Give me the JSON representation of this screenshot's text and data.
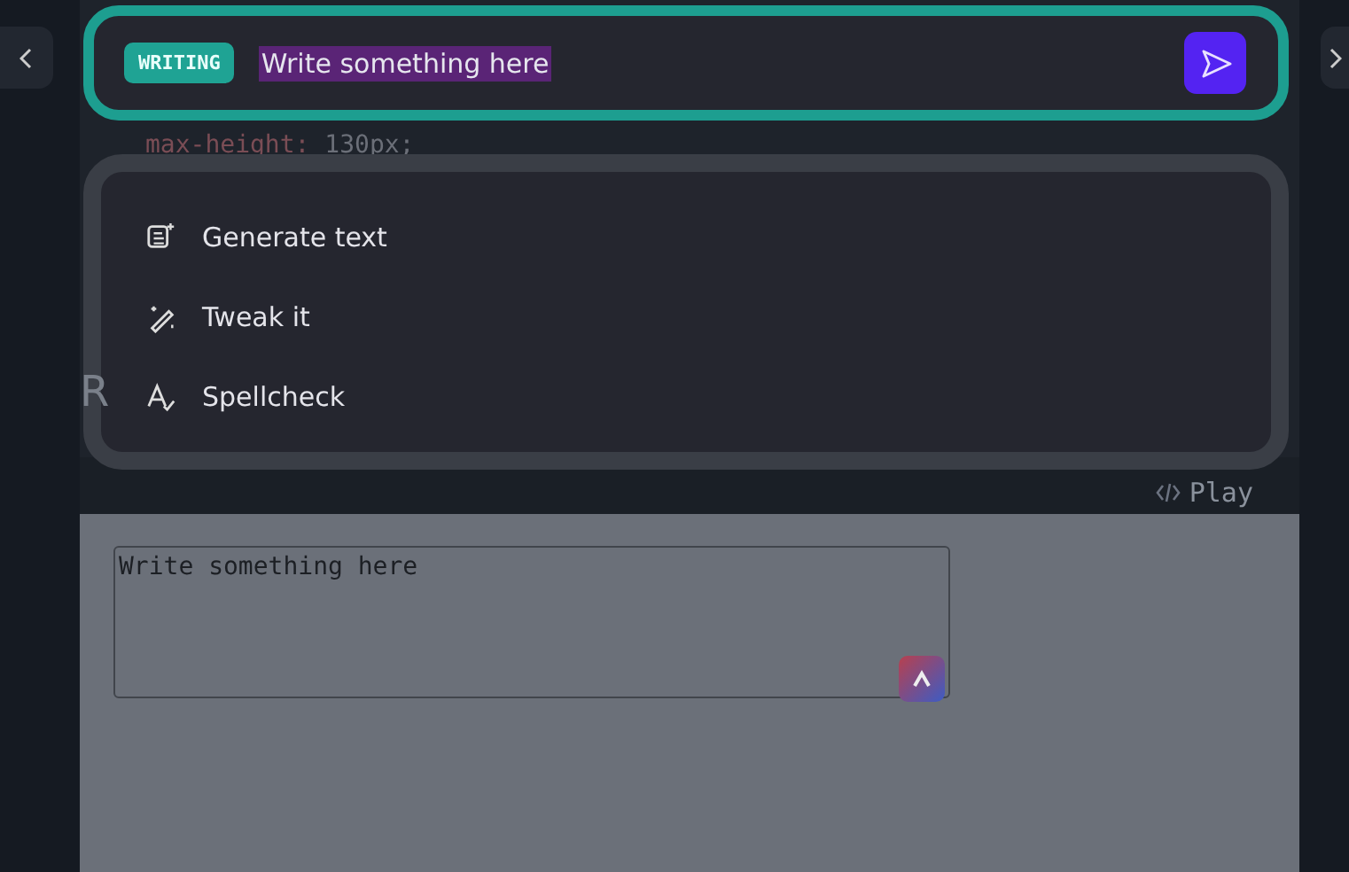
{
  "prompt_bar": {
    "badge": "WRITING",
    "value": "Write something here",
    "text_selected": true
  },
  "code": {
    "property": "max-height:",
    "value": "130px;"
  },
  "heading_fragment": "R",
  "menu": [
    {
      "kind": "generate",
      "label": "Generate text"
    },
    {
      "kind": "tweak",
      "label": "Tweak it"
    },
    {
      "kind": "spellcheck",
      "label": "Spellcheck"
    }
  ],
  "play_button": {
    "label": "Play"
  },
  "preview": {
    "textarea_value": "Write something here"
  }
}
